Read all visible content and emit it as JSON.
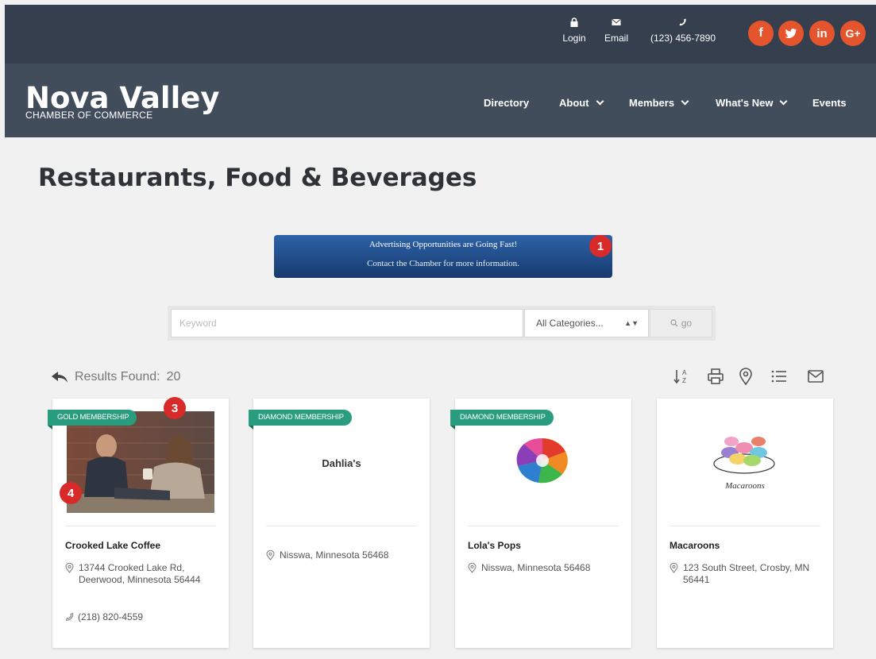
{
  "topbar": {
    "login_label": "Login",
    "email_label": "Email",
    "phone_label": "(123) 456-7890",
    "social": [
      {
        "name": "facebook-icon",
        "glyph": "f"
      },
      {
        "name": "twitter-icon",
        "glyph": "t"
      },
      {
        "name": "linkedin-icon",
        "glyph": "in"
      },
      {
        "name": "googleplus-icon",
        "glyph": "G+"
      }
    ],
    "social_color": "#e5552d"
  },
  "header": {
    "title": "Nova Valley",
    "subtitle": "CHAMBER OF COMMERCE",
    "nav": [
      "Directory",
      "About",
      "Members",
      "What's New",
      "Events"
    ]
  },
  "page": {
    "title": "Restaurants, Food & Beverages"
  },
  "banner": {
    "line1": "Advertising Opportunities are Going Fast!",
    "line2": "Contact the Chamber for more information."
  },
  "markers": [
    "1",
    "3",
    "4"
  ],
  "search": {
    "placeholder": "Keyword",
    "category": "All Categories...",
    "go_label": "go"
  },
  "results": {
    "label": "Results Found:",
    "count": "20"
  },
  "cards": [
    {
      "badge": "GOLD MEMBERSHIP",
      "name": "Crooked Lake Coffee",
      "address": "13744 Crooked Lake Rd, Deerwood, Minnesota 56444",
      "phone": "(218) 820-4559"
    },
    {
      "badge": "DIAMOND MEMBERSHIP",
      "logo_text": "Dahlia's",
      "name": "",
      "address": "Nisswa, Minnesota 56468"
    },
    {
      "badge": "DIAMOND MEMBERSHIP",
      "name": "Lola's Pops",
      "address": "Nisswa, Minnesota 56468"
    },
    {
      "badge": "",
      "logo_text": "Macaroons",
      "name": "Macaroons",
      "address": "123 South Street, Crosby, MN 56441"
    }
  ],
  "colors": {
    "topbar": "#353f4d",
    "header": "#424d5c",
    "ribbon": "#2a9d7e",
    "marker": "#d92a2a"
  }
}
